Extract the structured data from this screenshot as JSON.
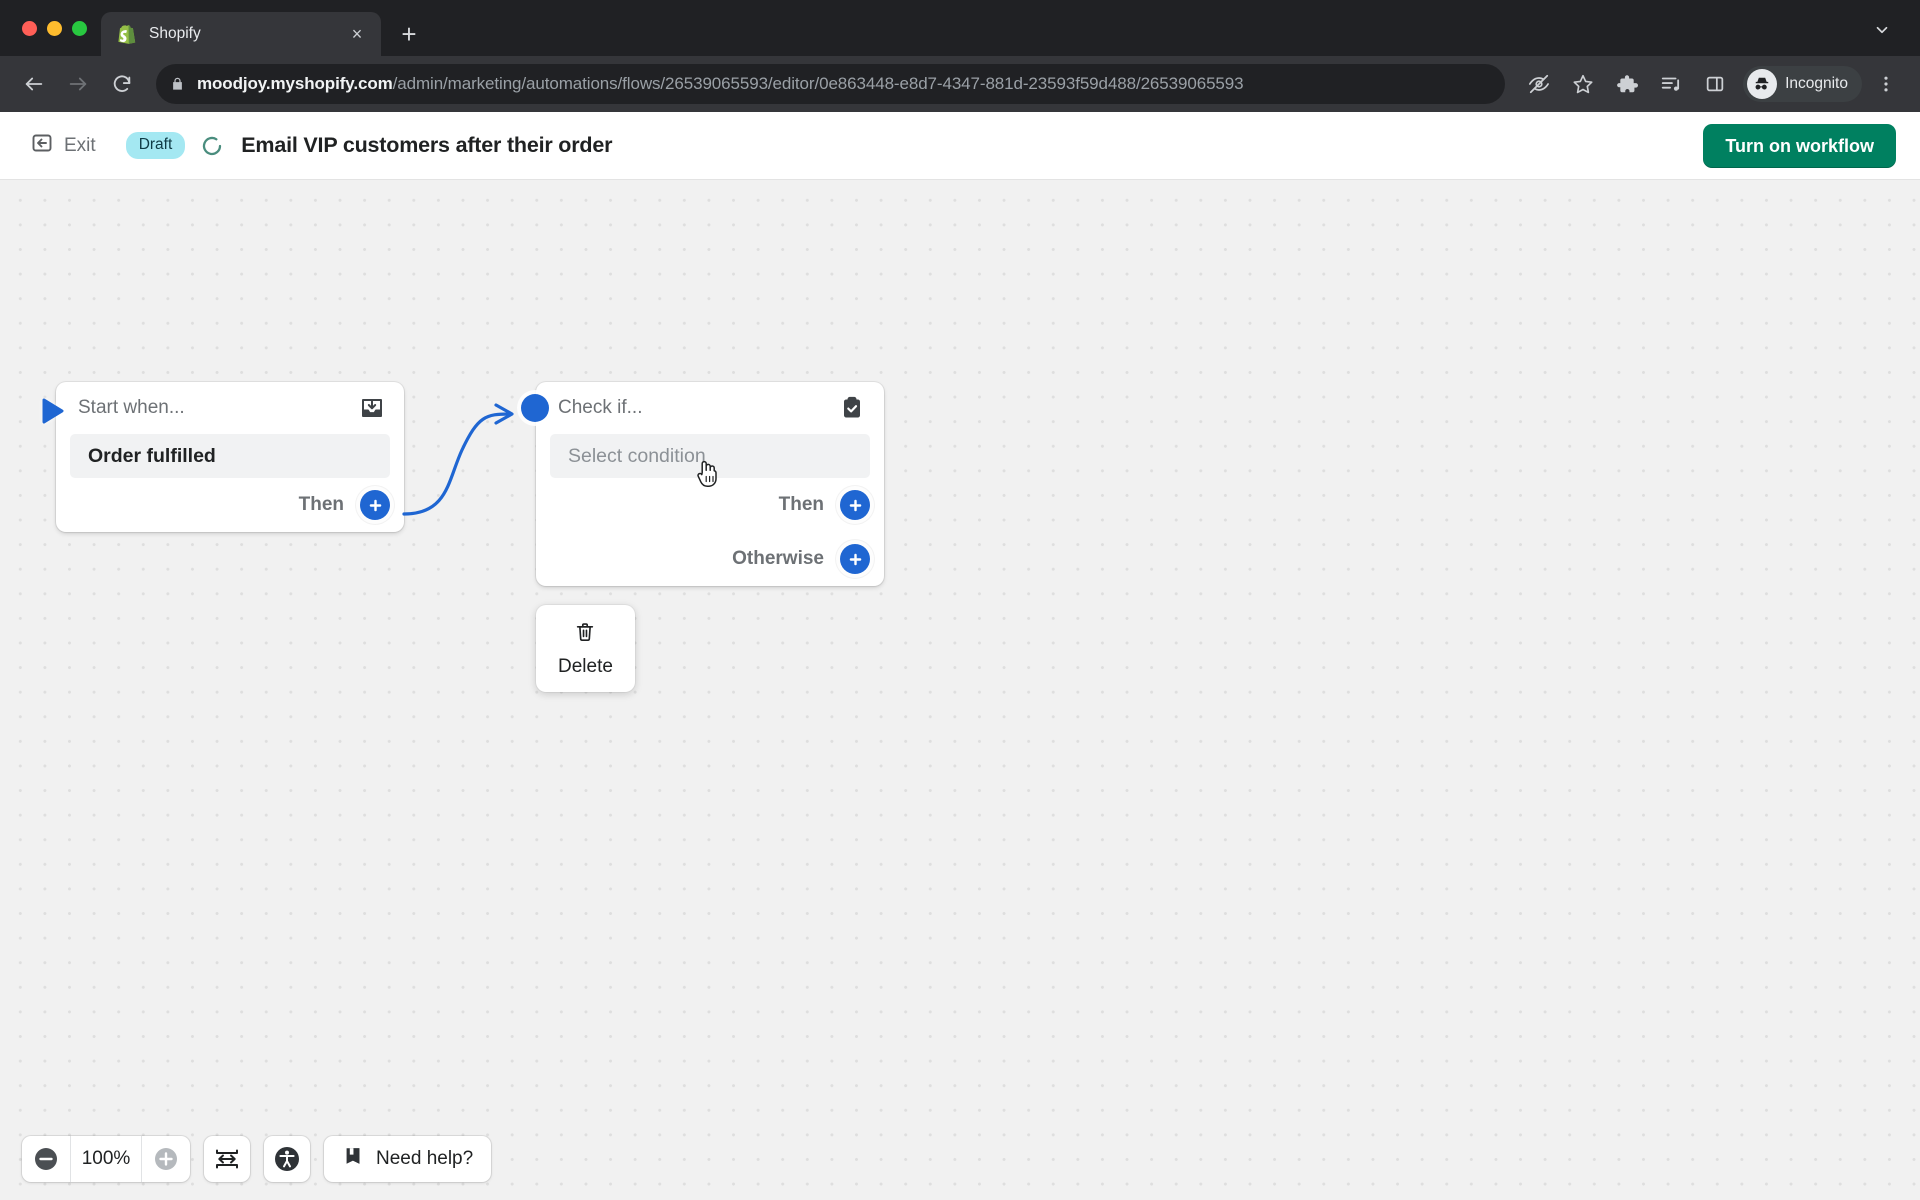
{
  "browser": {
    "tab": {
      "title": "Shopify",
      "favicon": "shopify-bag-icon",
      "close": "×"
    },
    "newtab_label": "+",
    "url": {
      "host": "moodjoy.myshopify.com",
      "path": "/admin/marketing/automations/flows/26539065593/editor/0e863448-e8d7-4347-881d-23593f59d488/26539065593"
    },
    "profile": {
      "label": "Incognito"
    },
    "icons": [
      "back-icon",
      "forward-icon",
      "reload-icon",
      "lock-icon",
      "tracking-protection-off-icon",
      "bookmark-star-icon",
      "extensions-puzzle-icon",
      "media-list-icon",
      "side-panel-icon",
      "incognito-avatar-icon",
      "browser-menu-icon",
      "tab-list-chevron-icon"
    ]
  },
  "app": {
    "exit_label": "Exit",
    "status_badge": "Draft",
    "title": "Email VIP customers after their order",
    "primary_button": "Turn on workflow",
    "accent_green": "#008060",
    "accent_blue": "#1f66d2",
    "badge_bg": "#a4e8f2"
  },
  "canvas": {
    "nodes": [
      {
        "id": "trigger",
        "head_label": "Start when...",
        "head_icon": "inbox-download-icon",
        "field_value": "Order fulfilled",
        "field_state": "filled",
        "rows": [
          {
            "label": "Then",
            "button": "add-step-plus-icon"
          }
        ],
        "marker": "start-play-marker"
      },
      {
        "id": "condition",
        "head_label": "Check if...",
        "head_icon": "clipboard-check-icon",
        "field_value": "Select condition",
        "field_state": "placeholder",
        "rows": [
          {
            "label": "Then",
            "button": "add-step-plus-icon"
          },
          {
            "label": "Otherwise",
            "button": "add-step-plus-icon"
          }
        ],
        "marker": "input-connection-dot"
      }
    ],
    "popover": {
      "label": "Delete",
      "icon": "trash-icon"
    },
    "cursor": "pointer-hand-cursor"
  },
  "bottombar": {
    "zoom_out": "zoom-out-icon",
    "zoom_level": "100%",
    "zoom_in": "zoom-in-icon",
    "fit_label": "fit-to-width-icon",
    "accessibility_label": "accessibility-icon",
    "help_label": "Need help?",
    "help_icon": "book-icon"
  }
}
